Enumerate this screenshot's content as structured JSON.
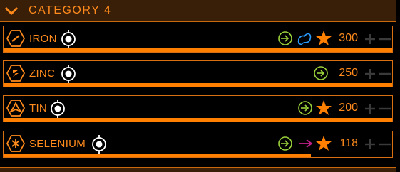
{
  "category": {
    "title": "CATEGORY 4"
  },
  "rows": [
    {
      "name": "IRON",
      "count": "300",
      "progress": 1.0,
      "icon": "iron-icon"
    },
    {
      "name": "ZINC",
      "count": "250",
      "progress": 1.0,
      "icon": "zinc-icon"
    },
    {
      "name": "TIN",
      "count": "200",
      "progress": 1.0,
      "icon": "tin-icon"
    },
    {
      "name": "SELENIUM",
      "count": "118",
      "progress": 0.79,
      "icon": "selenium-icon"
    }
  ],
  "colors": {
    "accent": "#ff8000",
    "text": "#ff8a1c",
    "header_bg": "#3a1f08",
    "target_green": "#9bd13a",
    "ship_blue": "#2a9cff",
    "trade_pink": "#c0208a"
  }
}
